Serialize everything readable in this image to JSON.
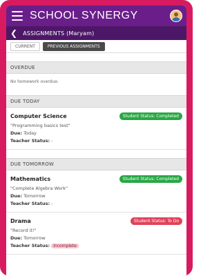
{
  "app": {
    "title": "SCHOOL SYNERGY"
  },
  "subheader": {
    "title": "ASSIGNMENTS (Maryam)"
  },
  "tabs": [
    {
      "label": "CURRENT"
    },
    {
      "label": "PREVIOUS ASSIGNMENTS"
    }
  ],
  "sections": {
    "overdue": {
      "title": "OVERDUE",
      "empty": "No homework overdue."
    },
    "due_today": {
      "title": "DUE TODAY",
      "items": [
        {
          "subject": "Computer Science",
          "badge": "Student Status: Completed",
          "title": "\"Programming basics test\"",
          "due_label": "Due:",
          "due_value": "Today",
          "teacher_label": "Teacher Status:",
          "teacher_value": "-"
        }
      ]
    },
    "due_tomorrow": {
      "title": "DUE TOMORROW",
      "items": [
        {
          "subject": "Mathematics",
          "badge": "Student Status: Completed",
          "title": "\"Complete Algebra Work\"",
          "due_label": "Due:",
          "due_value": "Tomorrow",
          "teacher_label": "Teacher Status:",
          "teacher_value": "-"
        },
        {
          "subject": "Drama",
          "badge": "Student Status: To Do",
          "title": "\"Record it!\"",
          "due_label": "Due:",
          "due_value": "Tomorrow",
          "teacher_label": "Teacher Status:",
          "teacher_value": "Incomplete"
        }
      ]
    }
  },
  "colors": {
    "frame": "#d81b60",
    "topbar": "#6a1e8a",
    "subbar": "#4d1768",
    "completed": "#28a745",
    "todo": "#e0425a"
  },
  "icons": {
    "menu": "hamburger-menu-icon",
    "back": "chevron-left-icon",
    "avatar": "user-avatar"
  }
}
